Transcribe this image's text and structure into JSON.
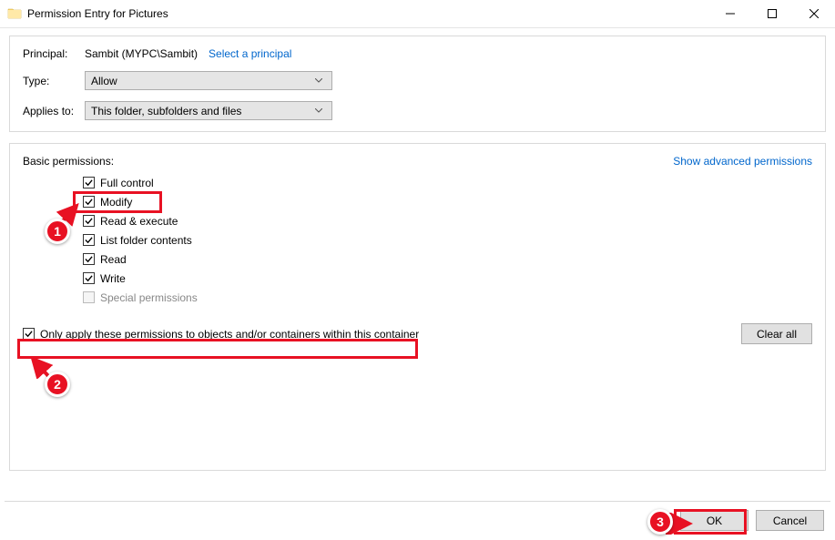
{
  "titlebar": {
    "title": "Permission Entry for Pictures"
  },
  "principal": {
    "label": "Principal:",
    "value": "Sambit (MYPC\\Sambit)",
    "select_link": "Select a principal"
  },
  "type": {
    "label": "Type:",
    "value": "Allow"
  },
  "applies_to": {
    "label": "Applies to:",
    "value": "This folder, subfolders and files"
  },
  "permissions": {
    "header": "Basic permissions:",
    "advanced_link": "Show advanced permissions",
    "items": [
      {
        "label": "Full control",
        "checked": true,
        "disabled": false
      },
      {
        "label": "Modify",
        "checked": true,
        "disabled": false
      },
      {
        "label": "Read & execute",
        "checked": true,
        "disabled": false
      },
      {
        "label": "List folder contents",
        "checked": true,
        "disabled": false
      },
      {
        "label": "Read",
        "checked": true,
        "disabled": false
      },
      {
        "label": "Write",
        "checked": true,
        "disabled": false
      },
      {
        "label": "Special permissions",
        "checked": false,
        "disabled": true
      }
    ]
  },
  "only_apply": {
    "label": "Only apply these permissions to objects and/or containers within this container",
    "checked": true
  },
  "buttons": {
    "clear_all": "Clear all",
    "ok": "OK",
    "cancel": "Cancel"
  },
  "annotations": {
    "badge1": "1",
    "badge2": "2",
    "badge3": "3"
  }
}
